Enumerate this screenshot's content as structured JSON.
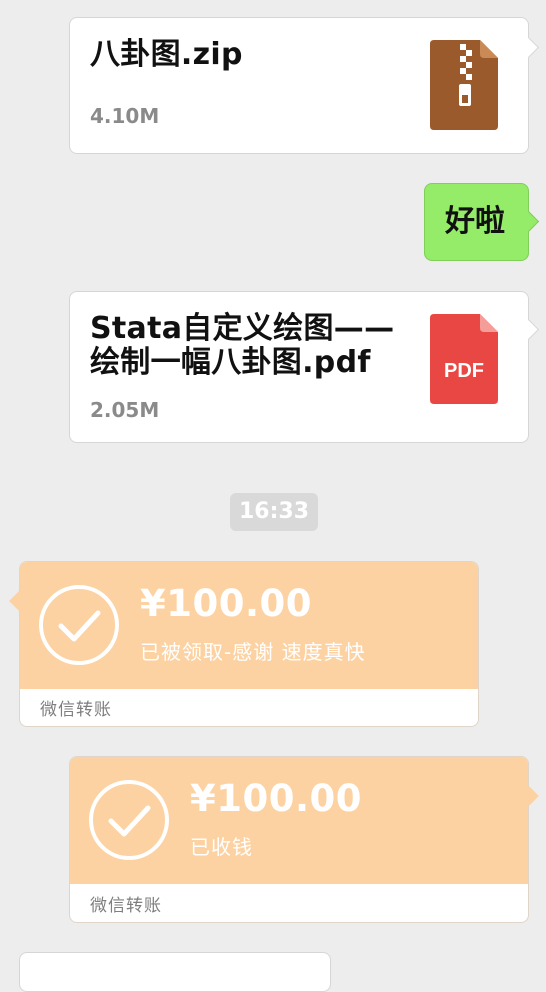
{
  "messages": {
    "file_zip": {
      "name": "八卦图.zip",
      "size": "4.10M",
      "icon": "zip-archive-icon",
      "icon_color": "#9a5a2b"
    },
    "text_reply": {
      "text": "好啦",
      "bubble_color": "#95ec69"
    },
    "file_pdf": {
      "name": "Stata自定义绘图——绘制一幅八卦图.pdf",
      "size": "2.05M",
      "icon": "pdf-file-icon",
      "icon_color": "#e94743",
      "icon_label": "PDF"
    },
    "timestamp": "16:33",
    "transfer_received": {
      "amount": "¥100.00",
      "status": "已被领取-感谢 速度真快",
      "footer": "微信转账",
      "icon": "check-circle-icon",
      "color": "#fdd2a2"
    },
    "transfer_collected": {
      "amount": "¥100.00",
      "status": "已收钱",
      "footer": "微信转账",
      "icon": "check-circle-icon",
      "color": "#fdd2a2"
    }
  }
}
